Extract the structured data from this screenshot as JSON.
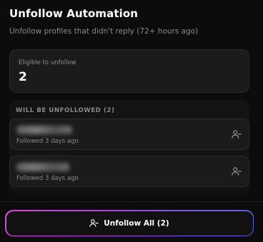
{
  "header": {
    "title": "Unfollow Automation",
    "subtitle": "Unfollow profiles that didn't reply (72+ hours ago)"
  },
  "stats": {
    "label": "Eligible to unfollow",
    "value": "2"
  },
  "list": {
    "section_title": "WILL BE UNFOLLOWED (2)",
    "items": [
      {
        "followed": "Followed 3 days ago",
        "icon": "user-minus-icon"
      },
      {
        "followed": "Followed 3 days ago",
        "icon": "user-minus-icon"
      }
    ]
  },
  "action": {
    "label": "Unfollow All (2)",
    "icon": "user-minus-icon"
  },
  "colors": {
    "background": "#0c0c0c",
    "card": "#1b1b1b",
    "gradient_start": "#d14bd6",
    "gradient_end": "#5a63e0"
  }
}
